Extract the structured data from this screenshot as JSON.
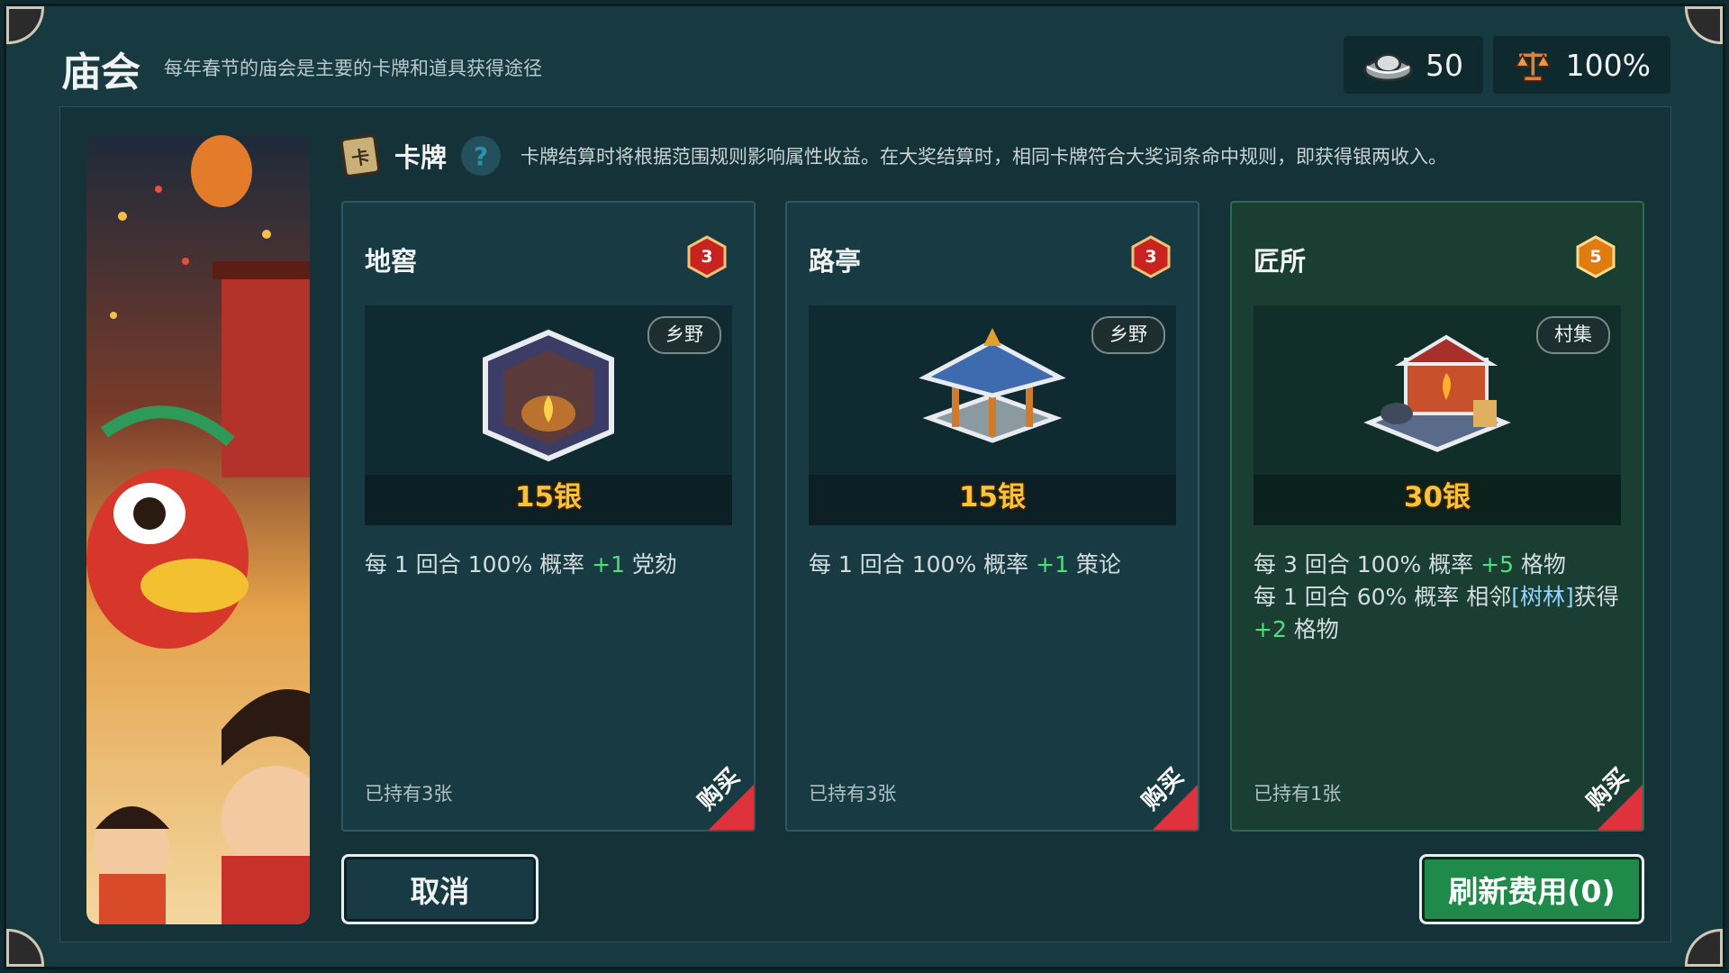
{
  "header": {
    "title": "庙会",
    "subtitle": "每年春节的庙会是主要的卡牌和道具获得途径"
  },
  "resources": {
    "silver": "50",
    "rate": "100%"
  },
  "section": {
    "title": "卡牌",
    "help": "?",
    "description": "卡牌结算时将根据范围规则影响属性收益。在大奖结算时，相同卡牌符合大奖词条命中规则，即获得银两收入。"
  },
  "cards": [
    {
      "name": "地窖",
      "badge": "3",
      "badge_color": "#c8231f",
      "tag": "乡野",
      "price": "15银",
      "desc": [
        {
          "pre": "每 1 回合 100% 概率 ",
          "plus": "+1",
          "post": " 党劾"
        }
      ],
      "owned": "已持有3张",
      "buy": "购买",
      "art": "cellar-icon"
    },
    {
      "name": "路亭",
      "badge": "3",
      "badge_color": "#c8231f",
      "tag": "乡野",
      "price": "15银",
      "desc": [
        {
          "pre": "每 1 回合 100% 概率 ",
          "plus": "+1",
          "post": " 策论"
        }
      ],
      "owned": "已持有3张",
      "buy": "购买",
      "art": "pavilion-icon"
    },
    {
      "name": "匠所",
      "badge": "5",
      "badge_color": "#e07b12",
      "tag": "村集",
      "price": "30银",
      "desc": [
        {
          "pre": "每 3 回合 100% 概率 ",
          "plus": "+5",
          "post": " 格物"
        },
        {
          "pre": "每 1 回合 60% 概率 相邻",
          "link": "[树林]",
          "pre2": "获得 ",
          "plus": "+2",
          "post": " 格物"
        }
      ],
      "owned": "已持有1张",
      "buy": "购买",
      "art": "workshop-icon"
    }
  ],
  "buttons": {
    "cancel": "取消",
    "refresh": "刷新费用(0)"
  },
  "colors": {
    "panel": "#173a41",
    "price": "#f6c33a",
    "plus": "#4de07a",
    "ribbon": "#e0323d",
    "refresh": "#1f8a49"
  }
}
